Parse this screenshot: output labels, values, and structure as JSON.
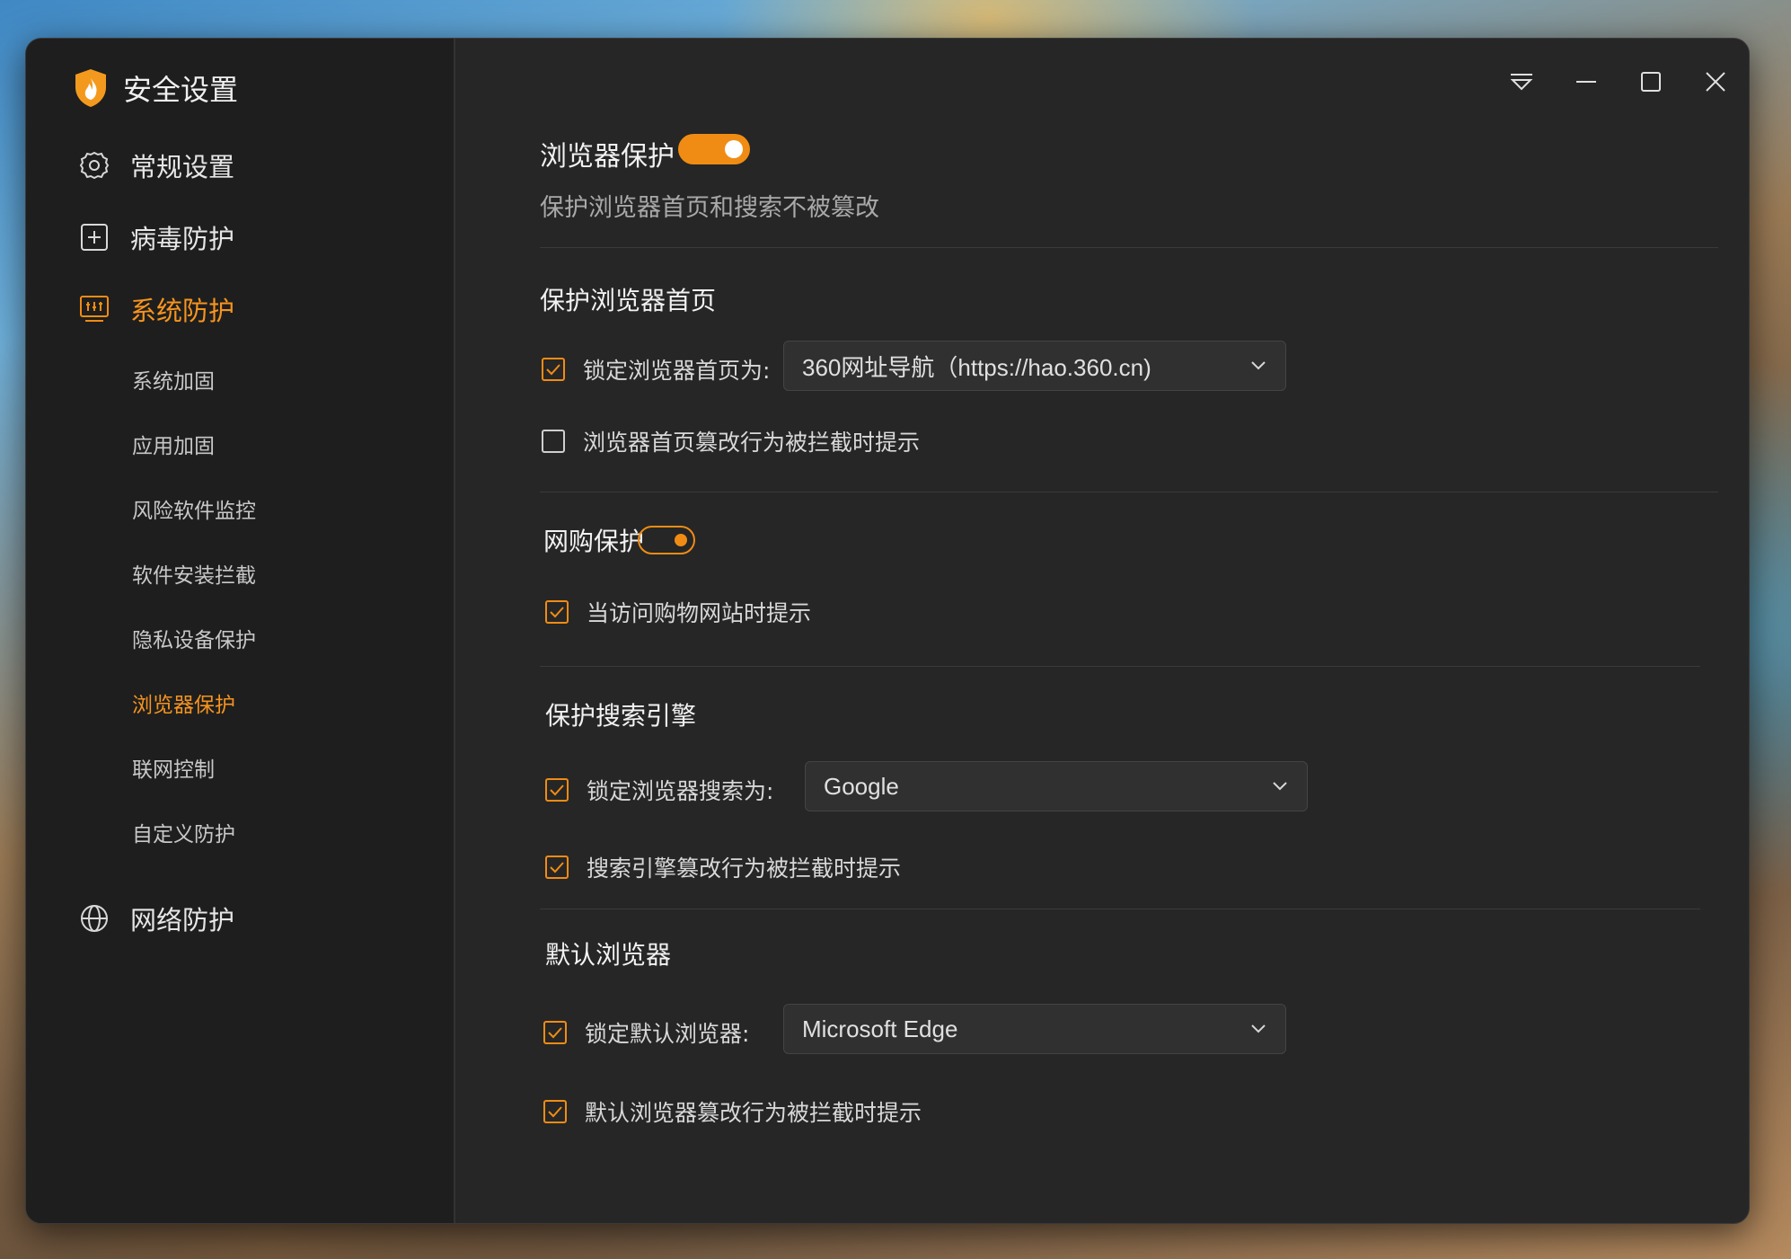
{
  "app": {
    "title": "安全设置"
  },
  "sidebar": {
    "main": [
      {
        "label": "常规设置",
        "icon": "gear-icon"
      },
      {
        "label": "病毒防护",
        "icon": "plus-box-icon"
      },
      {
        "label": "系统防护",
        "icon": "system-panel-icon"
      },
      {
        "label": "网络防护",
        "icon": "globe-icon"
      }
    ],
    "sub": [
      "系统加固",
      "应用加固",
      "风险软件监控",
      "软件安装拦截",
      "隐私设备保护",
      "浏览器保护",
      "联网控制",
      "自定义防护"
    ]
  },
  "colors": {
    "accent": "#f08c14",
    "bg": "#262626",
    "sidebar": "#1e1e1e"
  },
  "main": {
    "heading": "浏览器保护",
    "heading_toggle": "on",
    "description": "保护浏览器首页和搜索不被篡改",
    "homepage": {
      "title": "保护浏览器首页",
      "lock_label": "锁定浏览器首页为:",
      "lock_checked": true,
      "lock_value": "360网址导航（https://hao.360.cn)",
      "prompt_label": "浏览器首页篡改行为被拦截时提示",
      "prompt_checked": false
    },
    "shopping": {
      "title": "网购保护",
      "toggle": "on",
      "prompt_label": "当访问购物网站时提示",
      "prompt_checked": true
    },
    "search": {
      "title": "保护搜索引擎",
      "lock_label": "锁定浏览器搜索为:",
      "lock_checked": true,
      "lock_value": "Google",
      "prompt_label": "搜索引擎篡改行为被拦截时提示",
      "prompt_checked": true
    },
    "default_browser": {
      "title": "默认浏览器",
      "lock_label": "锁定默认浏览器:",
      "lock_checked": true,
      "lock_value": "Microsoft Edge",
      "prompt_label": "默认浏览器篡改行为被拦截时提示",
      "prompt_checked": true
    }
  }
}
